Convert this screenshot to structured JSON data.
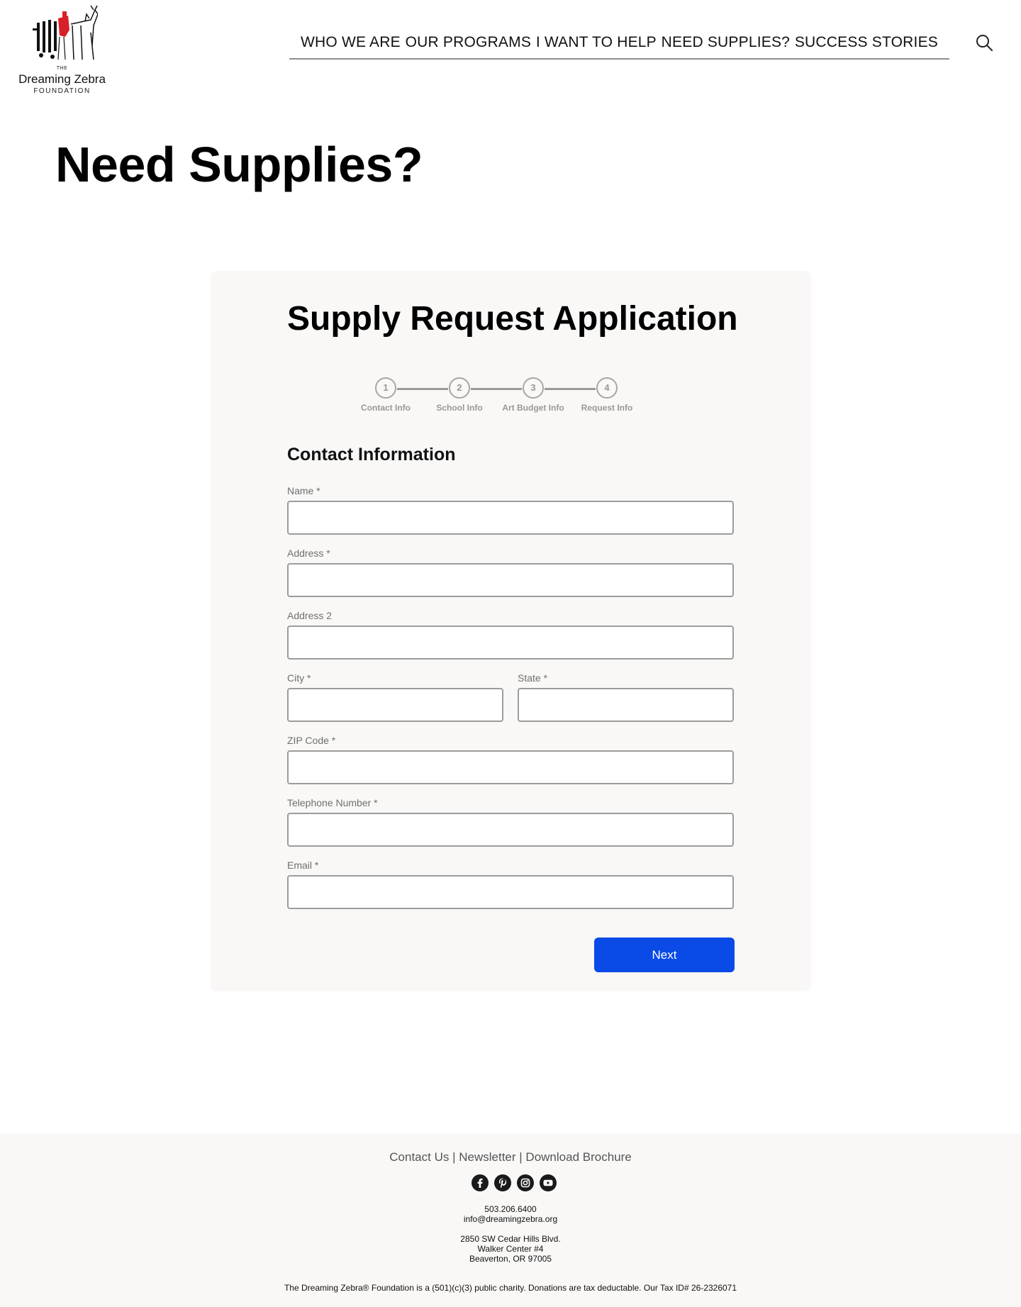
{
  "brand": {
    "logo_the": "THE",
    "logo_name": "Dreaming Zebra",
    "logo_foundation": "FOUNDATION"
  },
  "nav": {
    "items": [
      "WHO WE ARE",
      "OUR PROGRAMS",
      "I WANT TO HELP",
      "NEED SUPPLIES?",
      "SUCCESS STORIES"
    ],
    "search_icon": "search-icon"
  },
  "page": {
    "title": "Need Supplies?"
  },
  "form": {
    "title": "Supply Request Application",
    "steps": [
      {
        "number": "1",
        "label": "Contact Info"
      },
      {
        "number": "2",
        "label": "School Info"
      },
      {
        "number": "3",
        "label": "Art Budget Info"
      },
      {
        "number": "4",
        "label": "Request Info"
      }
    ],
    "section_title": "Contact Information",
    "fields": {
      "name": {
        "label": "Name *",
        "value": ""
      },
      "address": {
        "label": "Address *",
        "value": ""
      },
      "address2": {
        "label": "Address 2",
        "value": ""
      },
      "city": {
        "label": "City *",
        "value": ""
      },
      "state": {
        "label": "State *",
        "value": ""
      },
      "zip": {
        "label": "ZIP Code *",
        "value": ""
      },
      "phone": {
        "label": "Telephone Number *",
        "value": ""
      },
      "email": {
        "label": "Email *",
        "value": ""
      }
    },
    "next_label": "Next"
  },
  "footer": {
    "links": [
      "Contact Us",
      "Newsletter",
      "Download Brochure"
    ],
    "separator": " | ",
    "social_icons": [
      "facebook-icon",
      "pinterest-icon",
      "instagram-icon",
      "youtube-icon"
    ],
    "phone": "503.206.6400",
    "email": "info@dreamingzebra.org",
    "address_line1": "2850 SW Cedar Hills Blvd.",
    "address_line2": "Walker Center #4",
    "address_line3": "Beaverton, OR 97005",
    "disclaimer": "The Dreaming Zebra® Foundation is a (501)(c)(3) public charity. Donations are tax deductable. Our Tax ID# 26-2326071"
  },
  "colors": {
    "accent": "#0a4ae6",
    "logo_red": "#d8202a",
    "card_bg": "#f9f8f7",
    "footer_bg": "#f9f8f7"
  }
}
